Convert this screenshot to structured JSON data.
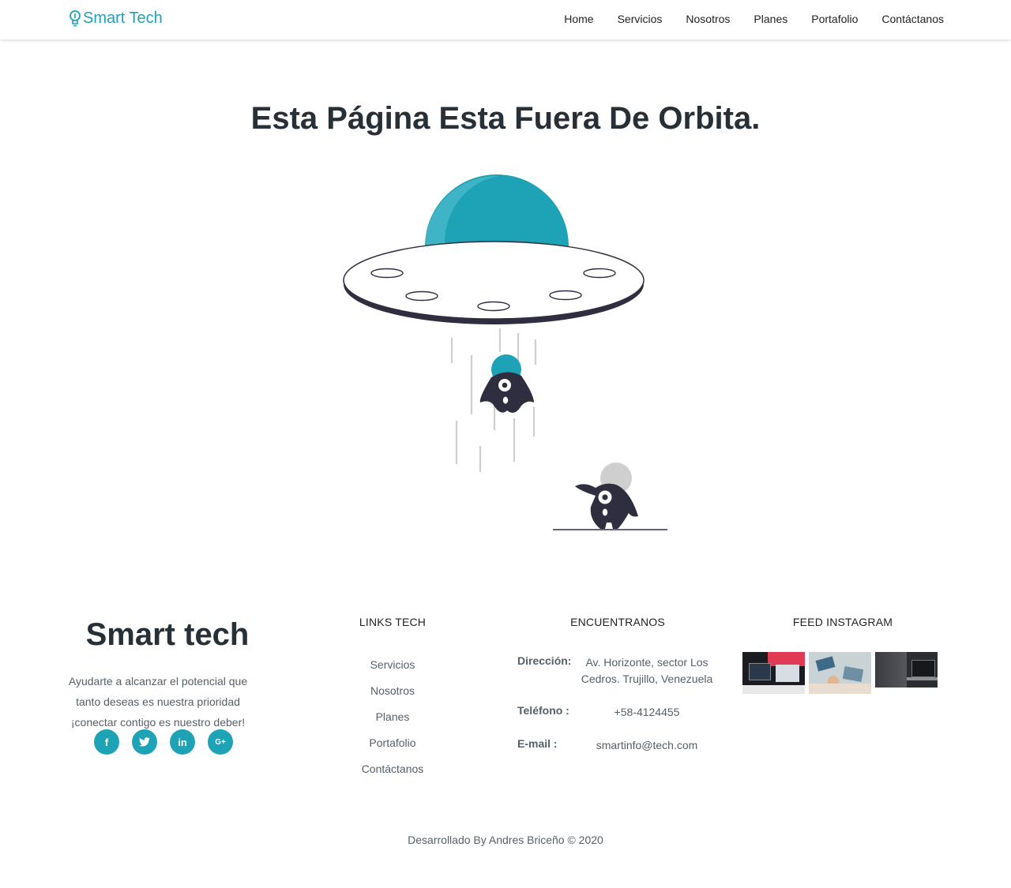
{
  "nav": {
    "brand": "Smart Tech",
    "links": [
      "Home",
      "Servicios",
      "Nosotros",
      "Planes",
      "Portafolio",
      "Contáctanos"
    ]
  },
  "hero": {
    "title": "Esta Página Esta Fuera De Orbita."
  },
  "footer": {
    "brand": "Smart tech",
    "tagline": "Ayudarte a alcanzar el potencial que tanto deseas es nuestra prioridad ¡conectar contigo es nuestro deber!",
    "socials": [
      "facebook-icon",
      "twitter-icon",
      "linkedin-icon",
      "google-plus-icon"
    ],
    "links_title": "LINKS TECH",
    "links": [
      "Servicios",
      "Nosotros",
      "Planes",
      "Portafolio",
      "Contáctanos"
    ],
    "contact_title": "ENCUENTRANOS",
    "contact": {
      "address_label": "Dirección:",
      "address": "Av. Horizonte, sector Los Cedros. Trujillo, Venezuela",
      "phone_label": "Teléfono :",
      "phone": "+58-4124455",
      "email_label": "E-mail :",
      "email": "smartinfo@tech.com"
    },
    "instagram_title": "FEED INSTAGRAM",
    "copyright": "Desarrollado By Andres Briceño © 2020"
  },
  "colors": {
    "accent": "#1ea2b6",
    "dark": "#2f2e41",
    "text": "#273036"
  }
}
